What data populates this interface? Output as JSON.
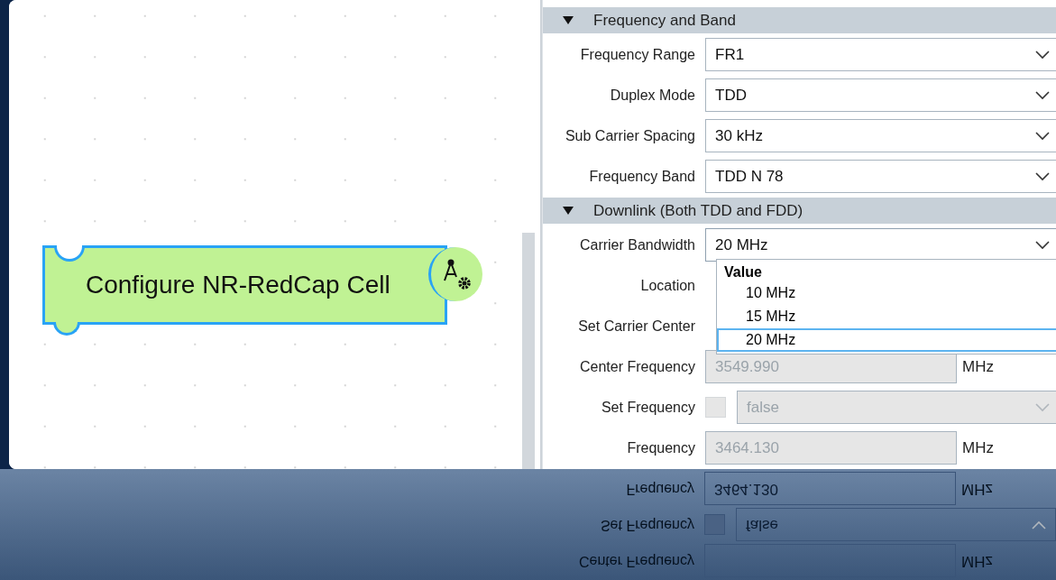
{
  "canvas": {
    "block": {
      "label": "Configure NR-RedCap Cell"
    }
  },
  "panel": {
    "sections": [
      {
        "title": "Frequency and Band",
        "expanded": true,
        "rows": [
          {
            "kind": "select",
            "label": "Frequency Range",
            "value": "FR1",
            "open": false
          },
          {
            "kind": "select",
            "label": "Duplex Mode",
            "value": "TDD",
            "open": false
          },
          {
            "kind": "select",
            "label": "Sub Carrier Spacing",
            "value": "30 kHz",
            "open": false
          },
          {
            "kind": "select",
            "label": "Frequency Band",
            "value": "TDD N 78",
            "open": false
          }
        ]
      },
      {
        "title": "Downlink (Both TDD and FDD)",
        "expanded": true,
        "rows": [
          {
            "kind": "select",
            "label": "Carrier Bandwidth",
            "value": "20 MHz",
            "open": true
          },
          {
            "kind": "covered",
            "label": "Location"
          },
          {
            "kind": "covered",
            "label": "Set Carrier Center"
          },
          {
            "kind": "number",
            "label": "Center Frequency",
            "value": "3549.990",
            "unit": "MHz",
            "disabled": true
          },
          {
            "kind": "check-select",
            "label": "Set Frequency",
            "checked": false,
            "value": "false",
            "disabled": true
          },
          {
            "kind": "number",
            "label": "Frequency",
            "value": "3464.130",
            "unit": "MHz",
            "disabled": true
          }
        ]
      }
    ]
  },
  "dropdown": {
    "header": "Value",
    "options": [
      {
        "label": "10 MHz",
        "selected": false
      },
      {
        "label": "15 MHz",
        "selected": false
      },
      {
        "label": "20 MHz",
        "selected": true
      }
    ]
  },
  "reflection": {
    "rows": [
      {
        "kind": "number",
        "label": "Frequency",
        "value": "3464.130",
        "unit": "MHz"
      },
      {
        "kind": "check-select",
        "label": "Set Frequency",
        "checked": false,
        "value": "false"
      },
      {
        "kind": "number",
        "label": "Center Frequency",
        "unit": "MHz"
      }
    ]
  }
}
